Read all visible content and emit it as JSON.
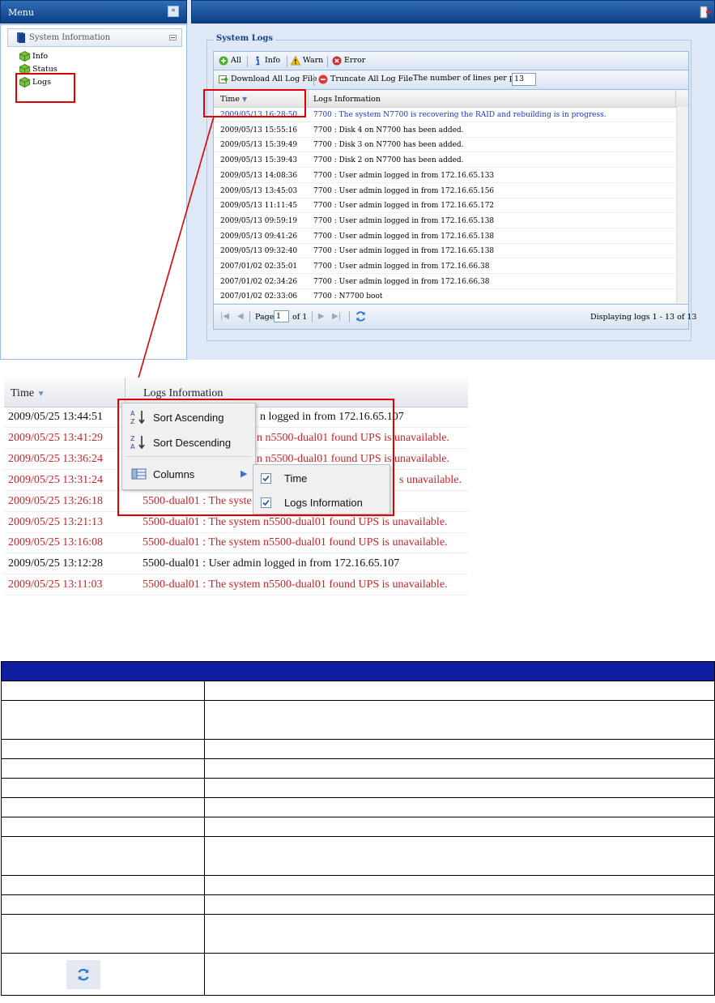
{
  "top": {
    "menu_title": "Menu",
    "collapse_glyph": "«",
    "menu_section": "System Information",
    "menu_items": [
      {
        "label": "Info",
        "icon": "green-box-icon"
      },
      {
        "label": "Status",
        "icon": "green-box-icon"
      },
      {
        "label": "Logs",
        "icon": "green-box-icon"
      }
    ],
    "logs_panel": {
      "legend": "System Logs",
      "filters": [
        {
          "label": "All",
          "icon": "green-plus-icon"
        },
        {
          "label": "Info",
          "icon": "info-icon"
        },
        {
          "label": "Warn",
          "icon": "warning-icon"
        },
        {
          "label": "Error",
          "icon": "error-icon"
        }
      ],
      "download_label": "Download All Log File",
      "truncate_label": "Truncate All Log File",
      "lines_label": "The number of lines per page",
      "lines_value": "13",
      "columns": [
        "Time",
        "Logs Information"
      ],
      "rows": [
        {
          "time": "2009/05/13 16:28:50",
          "info": "7700 : The system N7700 is recovering the RAID and rebuilding is in progress.",
          "level": "info"
        },
        {
          "time": "2009/05/13 15:55:16",
          "info": "7700 : Disk 4 on N7700 has been added.",
          "level": "normal"
        },
        {
          "time": "2009/05/13 15:39:49",
          "info": "7700 : Disk 3 on N7700 has been added.",
          "level": "normal"
        },
        {
          "time": "2009/05/13 15:39:43",
          "info": "7700 : Disk 2 on N7700 has been added.",
          "level": "normal"
        },
        {
          "time": "2009/05/13 14:08:36",
          "info": "7700 : User admin logged in from 172.16.65.133",
          "level": "normal"
        },
        {
          "time": "2009/05/13 13:45:03",
          "info": "7700 : User admin logged in from 172.16.65.156",
          "level": "normal"
        },
        {
          "time": "2009/05/13 11:11:45",
          "info": "7700 : User admin logged in from 172.16.65.172",
          "level": "normal"
        },
        {
          "time": "2009/05/13 09:59:19",
          "info": "7700 : User admin logged in from 172.16.65.138",
          "level": "normal"
        },
        {
          "time": "2009/05/13 09:41:26",
          "info": "7700 : User admin logged in from 172.16.65.138",
          "level": "normal"
        },
        {
          "time": "2009/05/13 09:32:40",
          "info": "7700 : User admin logged in from 172.16.65.138",
          "level": "normal"
        },
        {
          "time": "2007/01/02 02:35:01",
          "info": "7700 : User admin logged in from 172.16.66.38",
          "level": "normal"
        },
        {
          "time": "2007/01/02 02:34:26",
          "info": "7700 : User admin logged in from 172.16.66.38",
          "level": "normal"
        },
        {
          "time": "2007/01/02 02:33:06",
          "info": "7700 : N7700 boot",
          "level": "normal"
        }
      ],
      "pager": {
        "page_label": "Page",
        "page_value": "1",
        "of_label": "of 1",
        "display_text": "Displaying logs 1 - 13 of 13"
      }
    }
  },
  "zoom": {
    "columns": [
      "Time",
      "Logs Information"
    ],
    "rows": [
      {
        "time": "2009/05/25 13:44:51",
        "info": "n logged in from 172.16.65.107",
        "level": "normal"
      },
      {
        "time": "2009/05/25 13:41:29",
        "info": "n n5500-dual01 found UPS is unavailable.",
        "level": "error"
      },
      {
        "time": "2009/05/25 13:36:24",
        "info": "n n5500-dual01 found UPS is unavailable.",
        "level": "error"
      },
      {
        "time": "2009/05/25 13:31:24",
        "info": "s unavailable.",
        "level": "error"
      },
      {
        "time": "2009/05/25 13:26:18",
        "info": "5500-dual01 : The syste",
        "level": "error"
      },
      {
        "time": "2009/05/25 13:21:13",
        "info": "5500-dual01 : The system n5500-dual01 found UPS is unavailable.",
        "level": "error"
      },
      {
        "time": "2009/05/25 13:16:08",
        "info": "5500-dual01 : The system n5500-dual01 found UPS is unavailable.",
        "level": "error"
      },
      {
        "time": "2009/05/25 13:12:28",
        "info": "5500-dual01 : User admin logged in from 172.16.65.107",
        "level": "normal"
      },
      {
        "time": "2009/05/25 13:11:03",
        "info": "5500-dual01 : The system n5500-dual01 found UPS is unavailable.",
        "level": "error"
      }
    ],
    "context_menu": {
      "sort_ascending": "Sort Ascending",
      "sort_descending": "Sort Descending",
      "columns": "Columns"
    },
    "columns_submenu": [
      {
        "label": "Time",
        "checked": true
      },
      {
        "label": "Logs Information",
        "checked": true
      }
    ]
  },
  "colors": {
    "header_blue": "#0d3f86",
    "info_text": "#1a35c4",
    "error_text": "#c8242b",
    "highlight_red": "#e10000",
    "table_header": "#0d1f9e"
  }
}
